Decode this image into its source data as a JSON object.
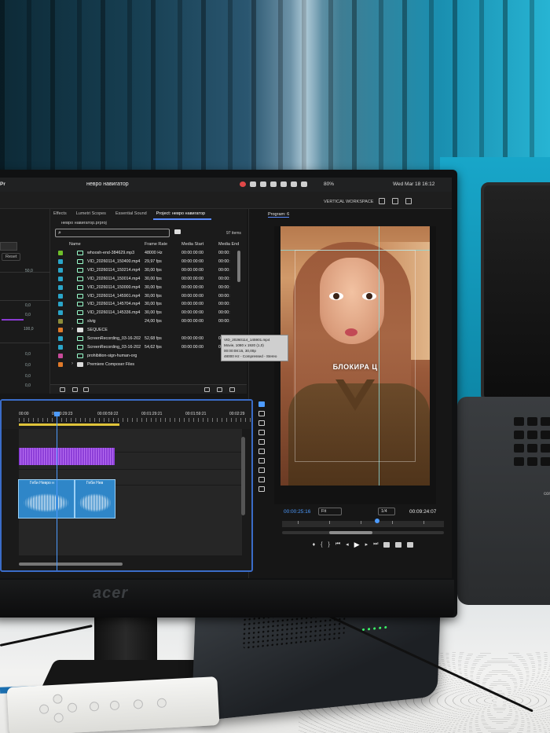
{
  "menubar": {
    "app_label": "Pr",
    "window_title": "невро навигатор",
    "battery": "80%",
    "datetime": "Wed Mar 18  16:12"
  },
  "workspace": {
    "label": "VERTICAL WORKSPACE"
  },
  "effects_panel": {
    "reset_label": "Reset",
    "values": [
      "50,0",
      "0,0",
      "0,0",
      "100,0",
      "0,0",
      "0,0",
      "0,0",
      "0,0"
    ]
  },
  "project_panel": {
    "tabs": [
      "Effects",
      "Lumetri Scopes",
      "Essential Sound",
      "Project: невро навигатор"
    ],
    "project_file": "невро навигатор.prproj",
    "item_count": "97 items",
    "columns": [
      "Name",
      "Frame Rate",
      "Media Start",
      "Media End"
    ],
    "files": [
      {
        "name": "whoosh-end-384629.mp3",
        "frame_rate": "48000 Hz",
        "media_start": "00:00:00:00",
        "media_end": "00:00:",
        "color": "#6fbf2a"
      },
      {
        "name": "VID_20260114_150400.mp4",
        "frame_rate": "29,97 fps",
        "media_start": "00:00:00:00",
        "media_end": "00:00:",
        "color": "#2aa5c9"
      },
      {
        "name": "VID_20260114_150214.mp4",
        "frame_rate": "30,00 fps",
        "media_start": "00:00:00:00",
        "media_end": "00:00:",
        "color": "#2aa5c9"
      },
      {
        "name": "VID_20260114_150014.mp4",
        "frame_rate": "30,00 fps",
        "media_start": "00:00:00:00",
        "media_end": "00:00:",
        "color": "#2aa5c9"
      },
      {
        "name": "VID_20260114_150000.mp4",
        "frame_rate": "30,00 fps",
        "media_start": "00:00:00:00",
        "media_end": "00:00:",
        "color": "#2aa5c9"
      },
      {
        "name": "VID_20260114_145901.mp4",
        "frame_rate": "30,00 fps",
        "media_start": "00:00:00:00",
        "media_end": "00:00:",
        "color": "#2aa5c9"
      },
      {
        "name": "VID_20260114_145704.mp4",
        "frame_rate": "30,00 fps",
        "media_start": "00:00:00:00",
        "media_end": "00:00:",
        "color": "#2aa5c9"
      },
      {
        "name": "VID_20260114_145336.mp4",
        "frame_rate": "30,00 fps",
        "media_start": "00:00:00:00",
        "media_end": "00:00:",
        "color": "#2aa5c9"
      },
      {
        "name": "slvig",
        "frame_rate": "24,00 fps",
        "media_start": "00:00:00:00",
        "media_end": "00:00:",
        "color": "#8c8c3a"
      },
      {
        "name": "SEQUECE",
        "frame_rate": "",
        "media_start": "",
        "media_end": "",
        "color": "#e07a2a",
        "folder": true
      },
      {
        "name": "ScreenRecording_03-16-202",
        "frame_rate": "52,68 fps",
        "media_start": "00:00:00:00",
        "media_end": "00:00:",
        "color": "#2aa5c9"
      },
      {
        "name": "ScreenRecording_03-16-202",
        "frame_rate": "54,62 fps",
        "media_start": "00:00:00:00",
        "media_end": "00:00:",
        "color": "#2aa5c9"
      },
      {
        "name": "prohibition-sign-human-org",
        "frame_rate": "",
        "media_start": "",
        "media_end": "",
        "color": "#c94a9a"
      },
      {
        "name": "Premiere Composer Files",
        "frame_rate": "",
        "media_start": "",
        "media_end": "",
        "color": "#e07a2a",
        "folder": true
      }
    ],
    "tooltip": [
      "VID_20260114_145901.mp4",
      "Movie, 1080 x 1920 (1,0)",
      "00:00:08:15, 30,00p",
      "48000 Hz - Compressed - Stereo"
    ]
  },
  "program_monitor": {
    "label": "Program: 6",
    "caption": "БЛОКИРА Ц",
    "timecode_current": "00:00:25:16",
    "fit": "Fit",
    "resolution": "1/4",
    "timecode_duration": "00:09:24:07"
  },
  "timeline": {
    "ruler": [
      "00:00",
      "00:00:29:23",
      "00:00:59:22",
      "00:01:29:21",
      "00:01:59:21",
      "00:02:29"
    ],
    "clip_labels": [
      "Геби Невро н",
      "Геби Нев"
    ]
  },
  "monitor": {
    "brand": "acer"
  },
  "laptop": {
    "key_label": "control"
  }
}
